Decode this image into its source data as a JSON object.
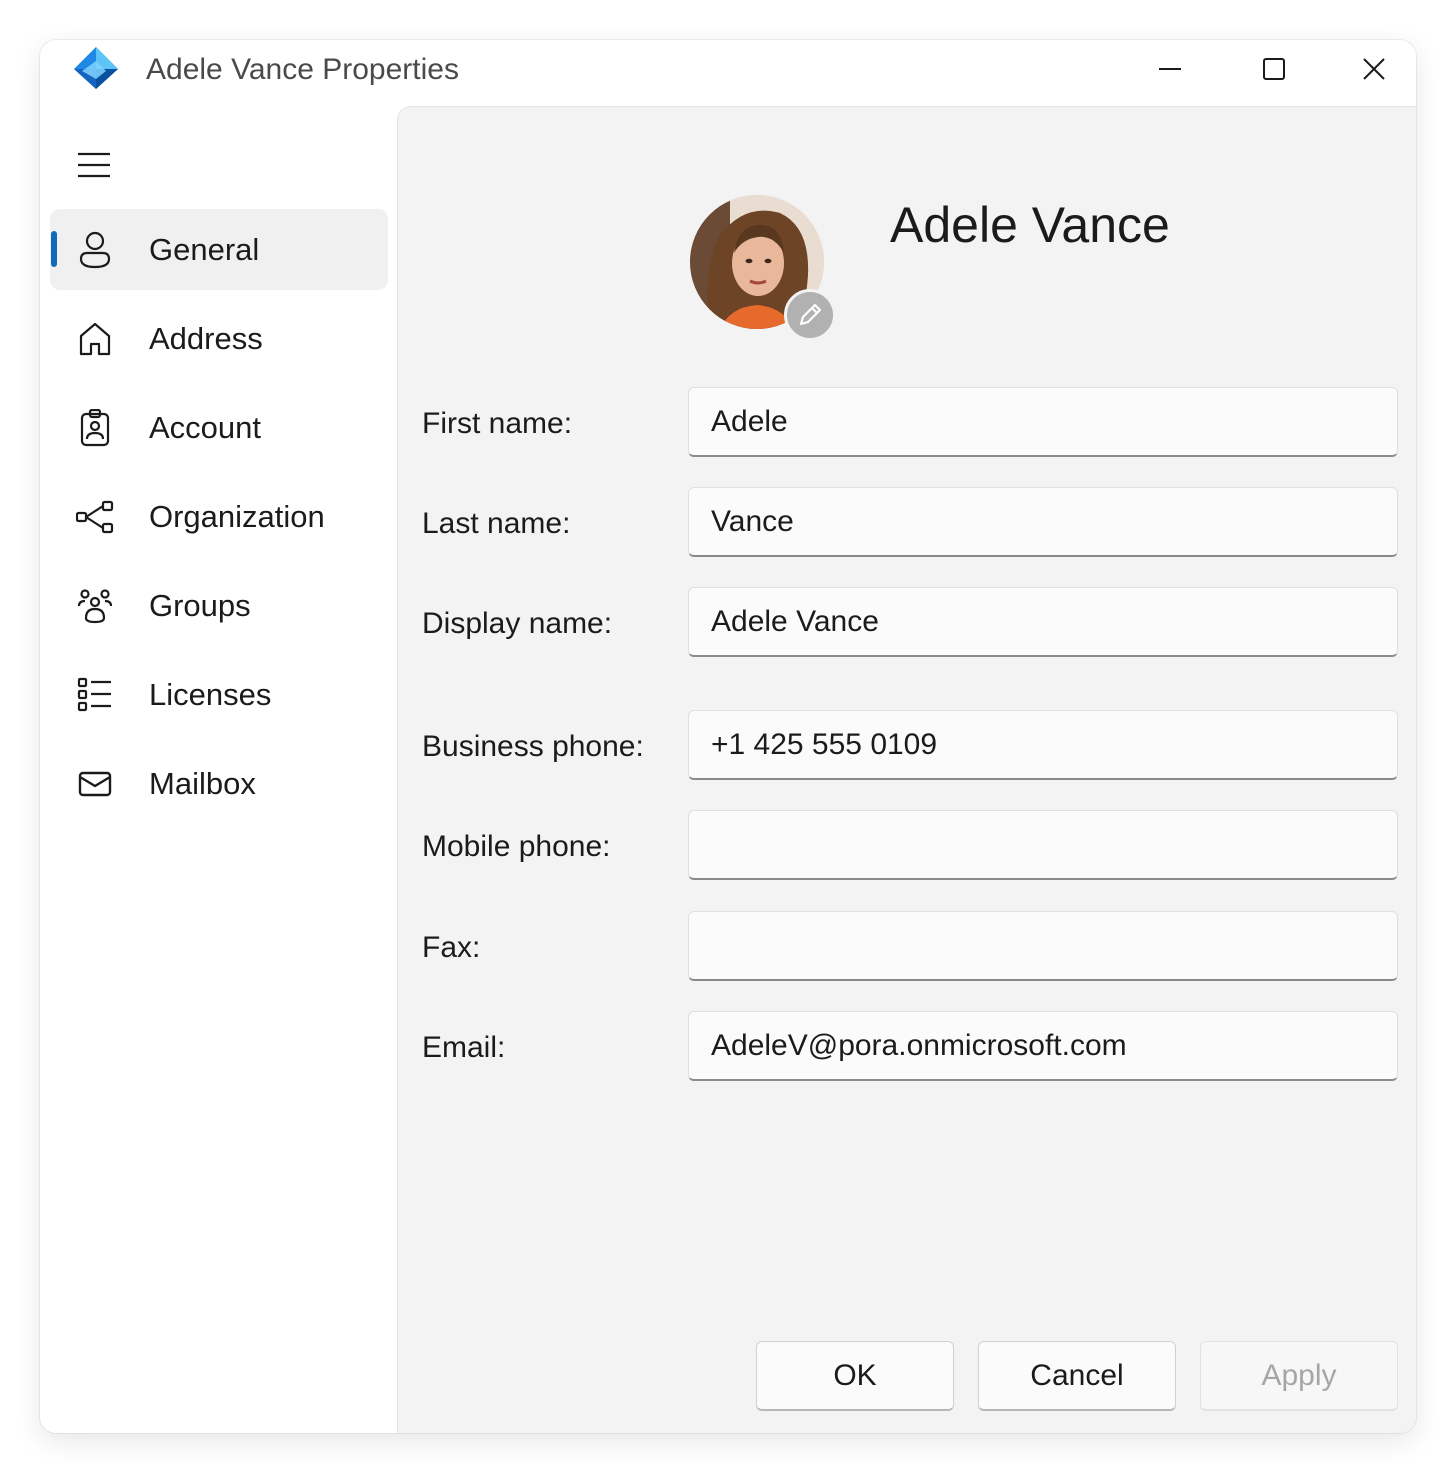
{
  "window": {
    "title": "Adele Vance Properties",
    "accent_color": "#0f6cbd",
    "icons": {
      "app": "azure-ad-diamond-icon",
      "minimize": "minimize-icon",
      "maximize": "maximize-icon",
      "close": "close-icon"
    }
  },
  "sidebar": {
    "menu_icon": "hamburger-icon",
    "items": [
      {
        "id": "general",
        "label": "General",
        "icon": "person-icon",
        "selected": true
      },
      {
        "id": "address",
        "label": "Address",
        "icon": "home-icon",
        "selected": false
      },
      {
        "id": "account",
        "label": "Account",
        "icon": "badge-icon",
        "selected": false
      },
      {
        "id": "organization",
        "label": "Organization",
        "icon": "org-chart-icon",
        "selected": false
      },
      {
        "id": "groups",
        "label": "Groups",
        "icon": "people-group-icon",
        "selected": false
      },
      {
        "id": "licenses",
        "label": "Licenses",
        "icon": "list-icon",
        "selected": false
      },
      {
        "id": "mailbox",
        "label": "Mailbox",
        "icon": "mail-icon",
        "selected": false
      }
    ]
  },
  "profile": {
    "name": "Adele Vance",
    "edit_icon": "pencil-icon"
  },
  "fields": {
    "first_name": {
      "label": "First name:",
      "value": "Adele"
    },
    "last_name": {
      "label": "Last name:",
      "value": "Vance"
    },
    "display_name": {
      "label": "Display name:",
      "value": "Adele Vance"
    },
    "business_phone": {
      "label": "Business phone:",
      "value": "+1 425 555 0109"
    },
    "mobile_phone": {
      "label": "Mobile phone:",
      "value": ""
    },
    "fax": {
      "label": "Fax:",
      "value": ""
    },
    "email": {
      "label": "Email:",
      "value": "AdeleV@pora.onmicrosoft.com"
    }
  },
  "buttons": {
    "ok": "OK",
    "cancel": "Cancel",
    "apply": "Apply",
    "apply_enabled": false
  }
}
